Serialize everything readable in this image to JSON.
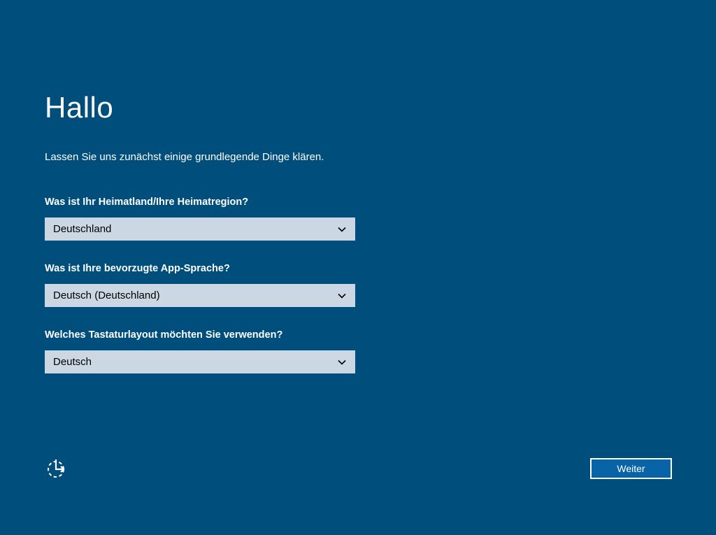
{
  "header": {
    "title": "Hallo",
    "subtitle": "Lassen Sie uns zunächst einige grundlegende Dinge klären."
  },
  "fields": {
    "country": {
      "label": "Was ist Ihr Heimatland/Ihre Heimatregion?",
      "value": "Deutschland"
    },
    "language": {
      "label": "Was ist Ihre bevorzugte App-Sprache?",
      "value": "Deutsch (Deutschland)"
    },
    "keyboard": {
      "label": "Welches Tastaturlayout möchten Sie verwenden?",
      "value": "Deutsch"
    }
  },
  "footer": {
    "next_label": "Weiter"
  }
}
